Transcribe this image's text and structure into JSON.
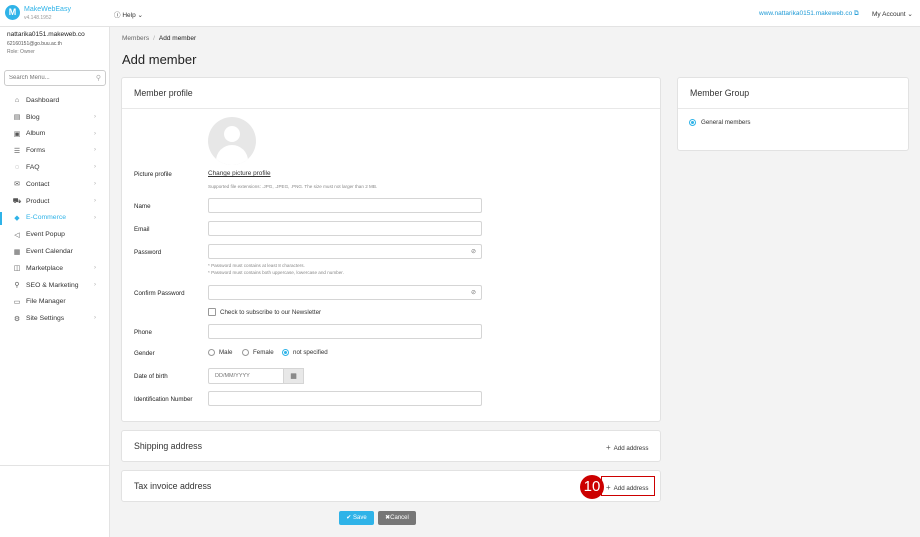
{
  "topbar": {
    "logo_letter": "M",
    "brand": "MakeWebEasy",
    "version": "v4.148.1952",
    "help": "Help",
    "site_link": "www.nattarika0151.makeweb.co",
    "account": "My Account"
  },
  "user": {
    "site": "nattarika0151.makeweb.co",
    "email": "62160151@go.buu.ac.th",
    "role": "Role: Owner"
  },
  "sidebar": {
    "search_placeholder": "Search Menu...",
    "items": [
      {
        "label": "Dashboard",
        "icon": "home-icon",
        "glyph": "⌂",
        "chevron": false
      },
      {
        "label": "Blog",
        "icon": "document-icon",
        "glyph": "▤",
        "chevron": true
      },
      {
        "label": "Album",
        "icon": "image-icon",
        "glyph": "▣",
        "chevron": true
      },
      {
        "label": "Forms",
        "icon": "list-icon",
        "glyph": "☰",
        "chevron": true
      },
      {
        "label": "FAQ",
        "icon": "chat-icon",
        "glyph": "◌",
        "chevron": true
      },
      {
        "label": "Contact",
        "icon": "mail-icon",
        "glyph": "✉",
        "chevron": true
      },
      {
        "label": "Product",
        "icon": "cart-icon",
        "glyph": "⛟",
        "chevron": true
      },
      {
        "label": "E-Commerce",
        "icon": "tag-icon",
        "glyph": "◆",
        "chevron": true,
        "active": true
      },
      {
        "label": "Event Popup",
        "icon": "megaphone-icon",
        "glyph": "◁",
        "chevron": false
      },
      {
        "label": "Event Calendar",
        "icon": "calendar-icon",
        "glyph": "▦",
        "chevron": false
      },
      {
        "label": "Marketplace",
        "icon": "bag-icon",
        "glyph": "◫",
        "chevron": true
      },
      {
        "label": "SEO & Marketing",
        "icon": "search-icon",
        "glyph": "⚲",
        "chevron": true
      },
      {
        "label": "File Manager",
        "icon": "folder-icon",
        "glyph": "▭",
        "chevron": false
      },
      {
        "label": "Site Settings",
        "icon": "gear-icon",
        "glyph": "⚙",
        "chevron": true
      }
    ]
  },
  "breadcrumb": {
    "parent": "Members",
    "current": "Add member"
  },
  "page_title": "Add member",
  "member_profile": {
    "title": "Member profile",
    "picture_label": "Picture profile",
    "change_picture": "Change picture profile",
    "picture_hint": "Supported file extensions: .JPG, .JPEG, .PNG. The size must not larger than 2 MB.",
    "name_label": "Name",
    "email_label": "Email",
    "password_label": "Password",
    "password_hint_1": "* Password must contains at least 8 characters.",
    "password_hint_2": "* Password must contains both uppercase, lowercase and number.",
    "confirm_password_label": "Confirm Password",
    "newsletter_label": "Check to subscribe to our Newsletter",
    "phone_label": "Phone",
    "gender_label": "Gender",
    "gender_options": [
      "Male",
      "Female",
      "not specified"
    ],
    "gender_selected": "not specified",
    "dob_label": "Date of birth",
    "dob_placeholder": "DD/MM/YYYY",
    "id_label": "Identification Number"
  },
  "shipping": {
    "title": "Shipping address",
    "add_label": "Add address"
  },
  "tax": {
    "title": "Tax invoice address",
    "add_label": "Add address",
    "step": "10"
  },
  "member_group": {
    "title": "Member Group",
    "option": "General members"
  },
  "actions": {
    "save": "Save",
    "cancel": "Cancel"
  }
}
